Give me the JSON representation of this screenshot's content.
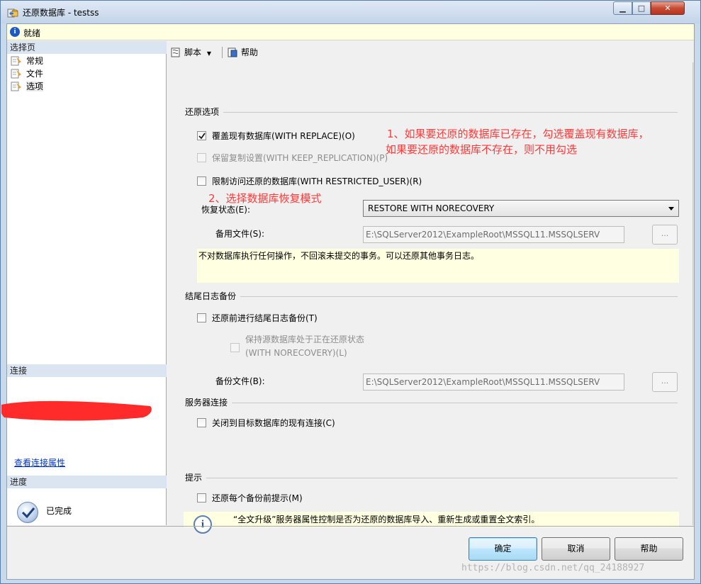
{
  "window": {
    "title": "还原数据库 - testss",
    "minimize": "▁",
    "maximize": "□",
    "close": "✕"
  },
  "status": {
    "text": "就绪",
    "icon": "info-icon"
  },
  "left_panel": {
    "select_page_header": "选择页",
    "pages": [
      {
        "label": "常规",
        "icon": "page-icon"
      },
      {
        "label": "文件",
        "icon": "page-icon"
      },
      {
        "label": "选项",
        "icon": "page-icon",
        "selected": true
      }
    ],
    "connection_header": "连接",
    "view_connection_link": "查看连接属性",
    "progress_header": "进度",
    "progress_status": "已完成"
  },
  "toolbar": {
    "script_label": "脚本",
    "help_label": "帮助"
  },
  "restore_options": {
    "title": "还原选项",
    "overwrite": {
      "label": "覆盖现有数据库(WITH REPLACE)(O)",
      "checked": true,
      "enabled": true
    },
    "keep_replication": {
      "label": "保留复制设置(WITH KEEP_REPLICATION)(P)",
      "checked": false,
      "enabled": false
    },
    "restricted_user": {
      "label": "限制访问还原的数据库(WITH RESTRICTED_USER)(R)",
      "checked": false,
      "enabled": true
    },
    "recovery_state_label": "恢复状态(E):",
    "recovery_state_value": "RESTORE WITH NORECOVERY",
    "standby_file_label": "备用文件(S):",
    "standby_file_value": "E:\\SQLServer2012\\ExampleRoot\\MSSQL11.MSSQLSERV",
    "browse_label": "...",
    "description": "不对数据库执行任何操作，不回滚未提交的事务。可以还原其他事务日志。"
  },
  "tail_log": {
    "title": "结尾日志备份",
    "backup_before": {
      "label": "还原前进行结尾日志备份(T)",
      "checked": false,
      "enabled": true
    },
    "leave_restoring_line1": "保持源数据库处于正在还原状态",
    "leave_restoring_line2": "(WITH NORECOVERY)(L)",
    "backup_file_label": "备份文件(B):",
    "backup_file_value": "E:\\SQLServer2012\\ExampleRoot\\MSSQL11.MSSQLSERV",
    "browse_label": "..."
  },
  "server_connections": {
    "title": "服务器连接",
    "close_existing": {
      "label": "关闭到目标数据库的现有连接(C)",
      "checked": false
    }
  },
  "prompt": {
    "title": "提示",
    "prompt_each": {
      "label": "还原每个备份前提示(M)",
      "checked": false
    },
    "info_text": "“全文升级”服务器属性控制是否为还原的数据库导入、重新生成或重置全文索引。"
  },
  "annotations": {
    "note1_line1": "1、如果要还原的数据库已存在，勾选覆盖现有数据库，",
    "note1_line2": "如果要还原的数据库不存在，则不用勾选",
    "note2": "2、选择数据库恢复模式"
  },
  "buttons": {
    "ok": "确定",
    "cancel": "取消",
    "help": "帮助"
  },
  "watermark": "https://blog.csdn.net/qq_24188927",
  "colors": {
    "annotation": "#ff3a3a",
    "info_bar": "#ffffe1",
    "link": "#0033cc",
    "redaction": "#ff2a2a"
  }
}
